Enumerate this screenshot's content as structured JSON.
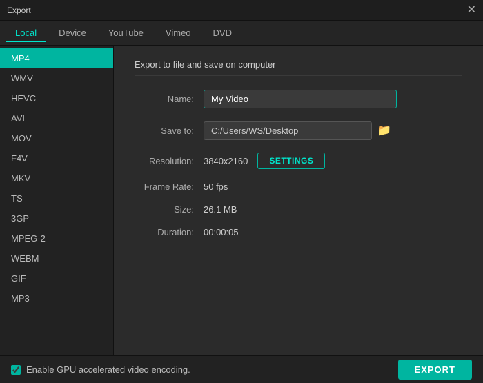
{
  "titlebar": {
    "title": "Export",
    "close_label": "✕"
  },
  "tabs": [
    {
      "id": "local",
      "label": "Local",
      "active": true
    },
    {
      "id": "device",
      "label": "Device",
      "active": false
    },
    {
      "id": "youtube",
      "label": "YouTube",
      "active": false
    },
    {
      "id": "vimeo",
      "label": "Vimeo",
      "active": false
    },
    {
      "id": "dvd",
      "label": "DVD",
      "active": false
    }
  ],
  "sidebar": {
    "items": [
      {
        "id": "mp4",
        "label": "MP4",
        "active": true
      },
      {
        "id": "wmv",
        "label": "WMV",
        "active": false
      },
      {
        "id": "hevc",
        "label": "HEVC",
        "active": false
      },
      {
        "id": "avi",
        "label": "AVI",
        "active": false
      },
      {
        "id": "mov",
        "label": "MOV",
        "active": false
      },
      {
        "id": "f4v",
        "label": "F4V",
        "active": false
      },
      {
        "id": "mkv",
        "label": "MKV",
        "active": false
      },
      {
        "id": "ts",
        "label": "TS",
        "active": false
      },
      {
        "id": "3gp",
        "label": "3GP",
        "active": false
      },
      {
        "id": "mpeg2",
        "label": "MPEG-2",
        "active": false
      },
      {
        "id": "webm",
        "label": "WEBM",
        "active": false
      },
      {
        "id": "gif",
        "label": "GIF",
        "active": false
      },
      {
        "id": "mp3",
        "label": "MP3",
        "active": false
      }
    ]
  },
  "content": {
    "section_title": "Export to file and save on computer",
    "name_label": "Name:",
    "name_value": "My Video",
    "name_placeholder": "My Video",
    "save_to_label": "Save to:",
    "save_to_value": "C:/Users/WS/Desktop",
    "resolution_label": "Resolution:",
    "resolution_value": "3840x2160",
    "settings_btn_label": "SETTINGS",
    "frame_rate_label": "Frame Rate:",
    "frame_rate_value": "50 fps",
    "size_label": "Size:",
    "size_value": "26.1 MB",
    "duration_label": "Duration:",
    "duration_value": "00:00:05"
  },
  "bottom": {
    "gpu_label": "Enable GPU accelerated video encoding.",
    "gpu_checked": true,
    "export_label": "EXPORT"
  },
  "icons": {
    "folder": "🗁",
    "close": "✕"
  }
}
